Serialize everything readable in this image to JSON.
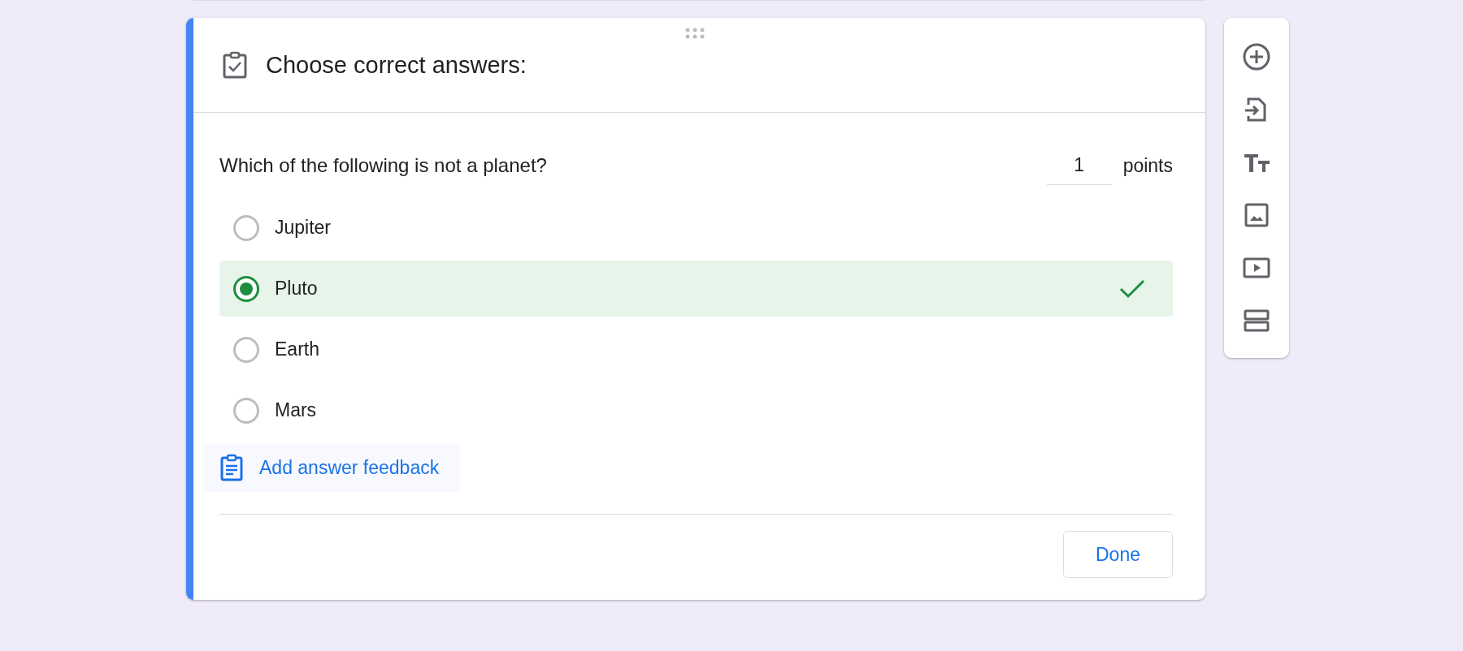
{
  "section_header": {
    "title": "Choose correct answers:"
  },
  "question": {
    "text": "Which of the following is not a planet?",
    "points_value": "1",
    "points_label": "points"
  },
  "options": [
    {
      "label": "Jupiter",
      "selected": false
    },
    {
      "label": "Pluto",
      "selected": true
    },
    {
      "label": "Earth",
      "selected": false
    },
    {
      "label": "Mars",
      "selected": false
    }
  ],
  "feedback_button": "Add answer feedback",
  "done_button": "Done",
  "toolbar": [
    {
      "kind": "add"
    },
    {
      "kind": "import"
    },
    {
      "kind": "title"
    },
    {
      "kind": "image"
    },
    {
      "kind": "video"
    },
    {
      "kind": "section"
    }
  ]
}
